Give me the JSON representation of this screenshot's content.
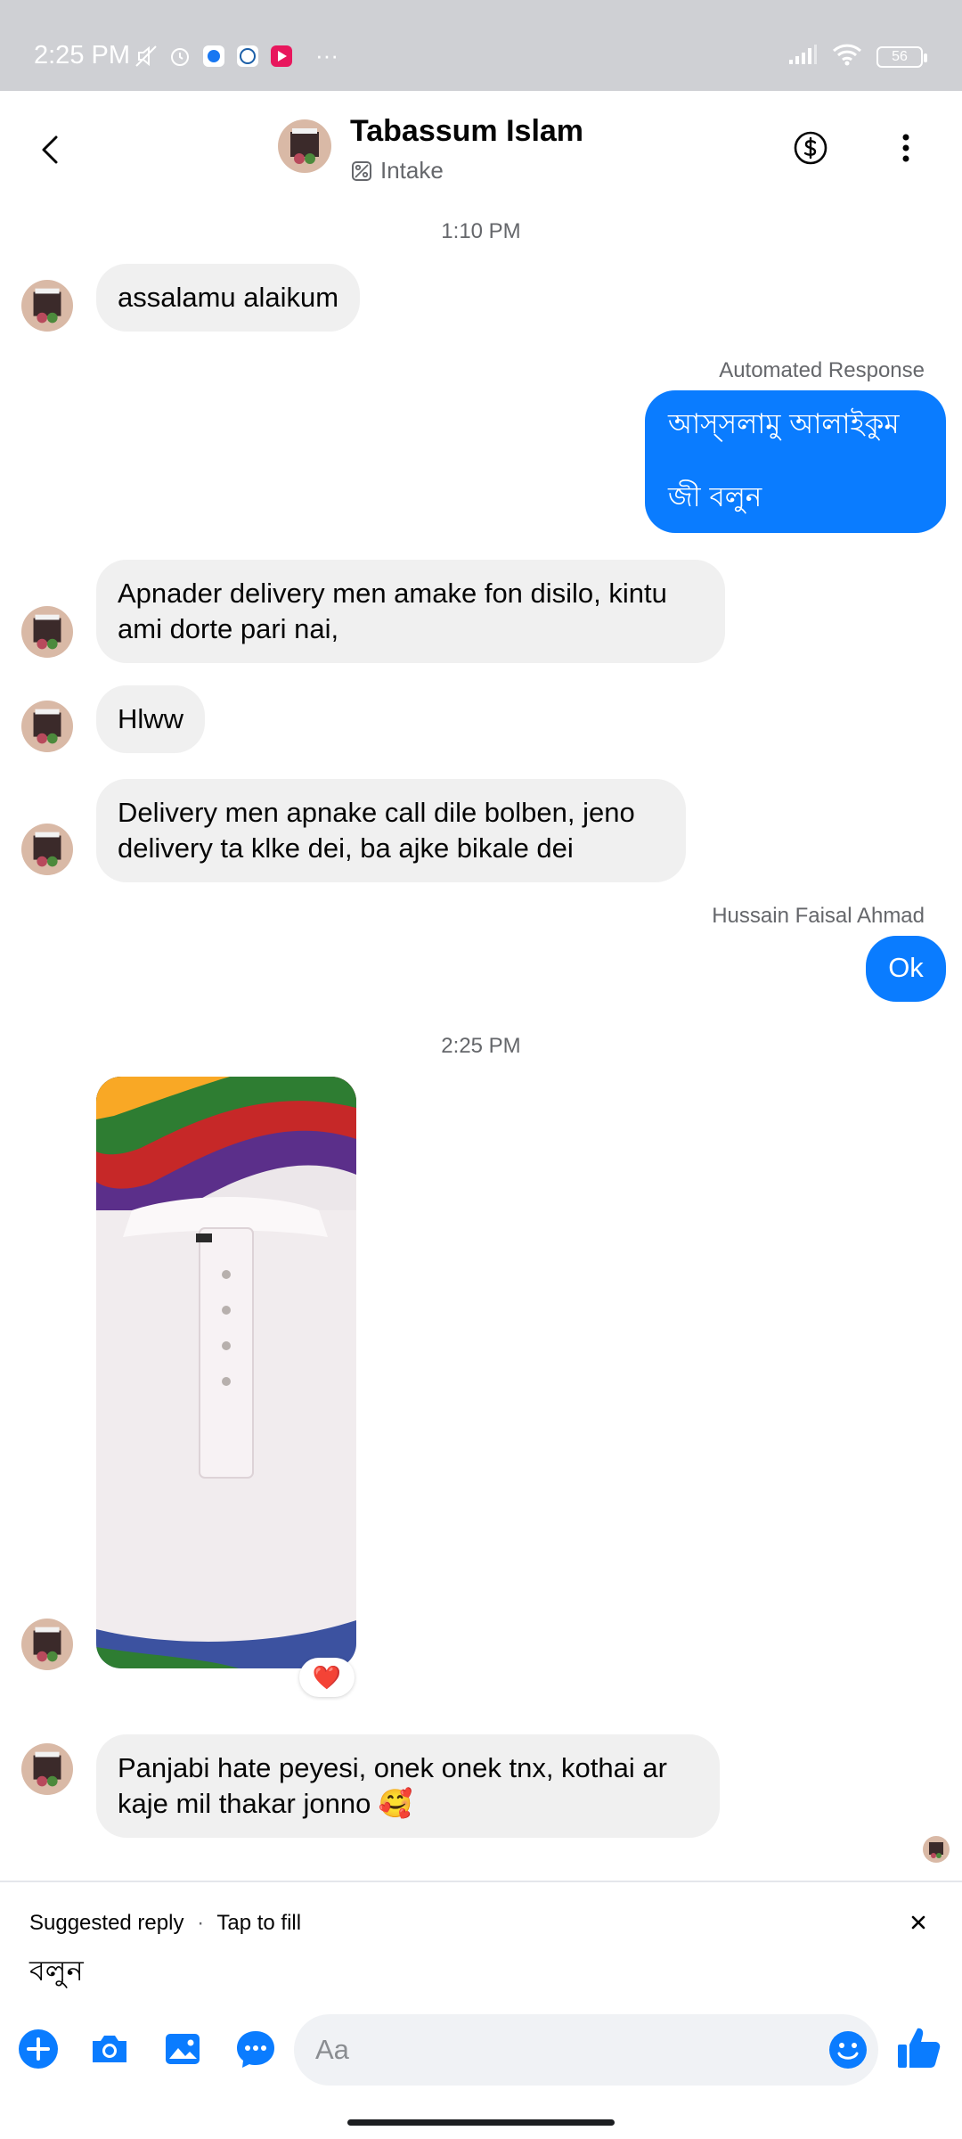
{
  "status_bar": {
    "time": "2:25 PM",
    "battery": "56",
    "more": "···"
  },
  "header": {
    "contact_name": "Tabassum Islam",
    "label": "Intake"
  },
  "messages": {
    "time_1": "1:10 PM",
    "m1": "assalamu alaikum",
    "auto_label": "Automated Response",
    "auto_line1": "আস্সলামু আলাইকুম",
    "auto_line2": "জী বলুন",
    "m2": "Apnader delivery men amake fon disilo, kintu ami dorte pari nai,",
    "m3": "Hlww",
    "m4": "Delivery men apnake call dile bolben, jeno delivery ta klke dei, ba ajke bikale dei",
    "sender_label": "Hussain Faisal Ahmad",
    "ok": "Ok",
    "time_2": "2:25 PM",
    "reaction": "❤️",
    "m5": "Panjabi hate peyesi, onek onek tnx, kothai ar kaje mil thakar jonno 🥰"
  },
  "suggested": {
    "title": "Suggested reply",
    "dot": "·",
    "hint": "Tap to fill",
    "reply": "বলুন"
  },
  "composer": {
    "placeholder": "Aa"
  },
  "colors": {
    "accent": "#0a7cff",
    "incoming_bubble": "#f0f0f0",
    "status_bar_bg": "#cfd0d4"
  },
  "icons": [
    "back-arrow-icon",
    "dollar-icon",
    "more-vertical-icon",
    "plus-icon",
    "camera-icon",
    "image-icon",
    "chat-bubble-icon",
    "emoji-icon",
    "thumbs-up-icon",
    "close-icon"
  ]
}
